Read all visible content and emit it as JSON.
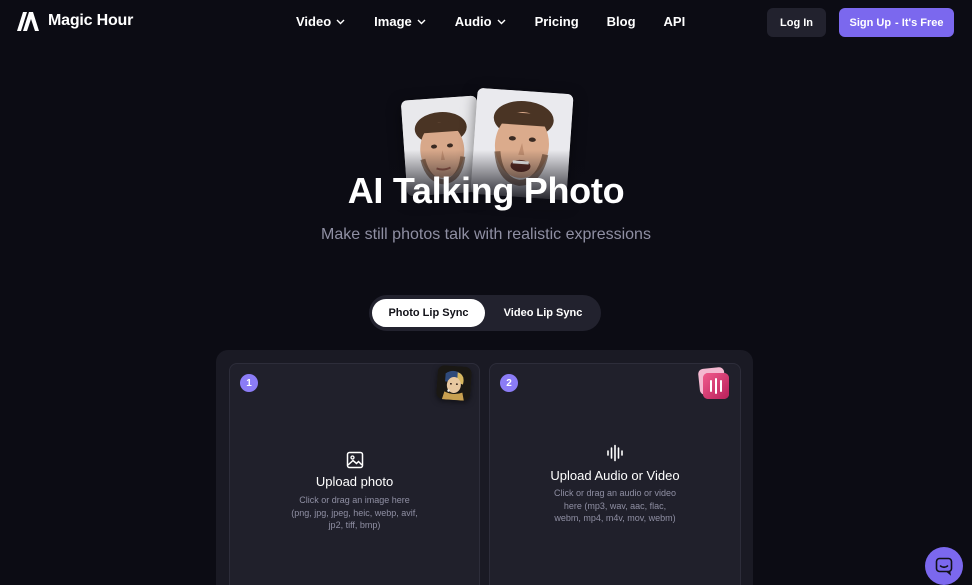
{
  "brand": {
    "name": "Magic Hour",
    "logo_icon": "magic-hour-logo-icon",
    "accent_color": "#7b68ee"
  },
  "nav": {
    "items": [
      {
        "label": "Video",
        "has_dropdown": true
      },
      {
        "label": "Image",
        "has_dropdown": true
      },
      {
        "label": "Audio",
        "has_dropdown": true
      },
      {
        "label": "Pricing",
        "has_dropdown": false
      },
      {
        "label": "Blog",
        "has_dropdown": false
      },
      {
        "label": "API",
        "has_dropdown": false
      }
    ],
    "login_label": "Log In",
    "signup_label": "Sign Up",
    "signup_suffix": "- It's Free"
  },
  "hero": {
    "title": "AI Talking Photo",
    "subtitle": "Make still photos talk with realistic expressions"
  },
  "mode_toggle": {
    "options": [
      "Photo Lip Sync",
      "Video Lip Sync"
    ],
    "selected": "Photo Lip Sync"
  },
  "upload": {
    "photo": {
      "step": "1",
      "title": "Upload photo",
      "description": "Click or drag an image here (png, jpg, jpeg, heic, webp, avif, jp2, tiff, bmp)",
      "icon": "image-icon",
      "thumbnail": "painting-thumbnail"
    },
    "audio": {
      "step": "2",
      "title": "Upload Audio or Video",
      "description": "Click or drag an audio or video here (mp3, wav, aac, flac, webm, mp4, m4v, mov, webm)",
      "icon": "audio-waveform-icon",
      "thumbnail": "audio-file-thumbnail"
    }
  },
  "chat": {
    "icon": "chat-bubble-icon"
  }
}
